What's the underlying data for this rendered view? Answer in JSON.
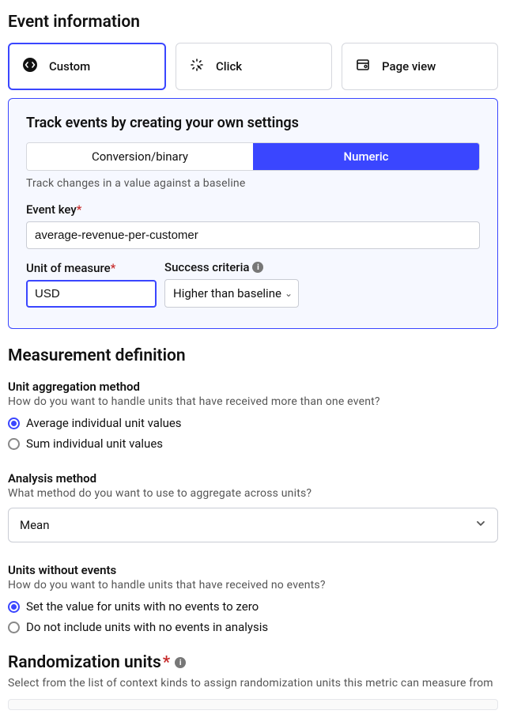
{
  "sections": {
    "event_info": "Event information",
    "measurement": "Measurement definition",
    "randomization": "Randomization units"
  },
  "event_types": {
    "custom": "Custom",
    "click": "Click",
    "page_view": "Page view"
  },
  "custom_panel": {
    "heading": "Track events by creating your own settings",
    "seg_conversion": "Conversion/binary",
    "seg_numeric": "Numeric",
    "hint": "Track changes in a value against a baseline",
    "event_key_label": "Event key",
    "event_key_value": "average-revenue-per-customer",
    "unit_label": "Unit of measure",
    "unit_value": "USD",
    "success_label": "Success criteria",
    "success_value": "Higher than baseline"
  },
  "unit_aggregation": {
    "label": "Unit aggregation method",
    "hint": "How do you want to handle units that have received more than one event?",
    "opt_avg": "Average individual unit values",
    "opt_sum": "Sum individual unit values"
  },
  "analysis": {
    "label": "Analysis method",
    "hint": "What method do you want to use to aggregate across units?",
    "value": "Mean"
  },
  "units_without": {
    "label": "Units without events",
    "hint": "How do you want to handle units that have received no events?",
    "opt_zero": "Set the value for units with no events to zero",
    "opt_exclude": "Do not include units with no events in analysis"
  },
  "randomization": {
    "hint": "Select from the list of context kinds to assign randomization units this metric can measure from"
  }
}
